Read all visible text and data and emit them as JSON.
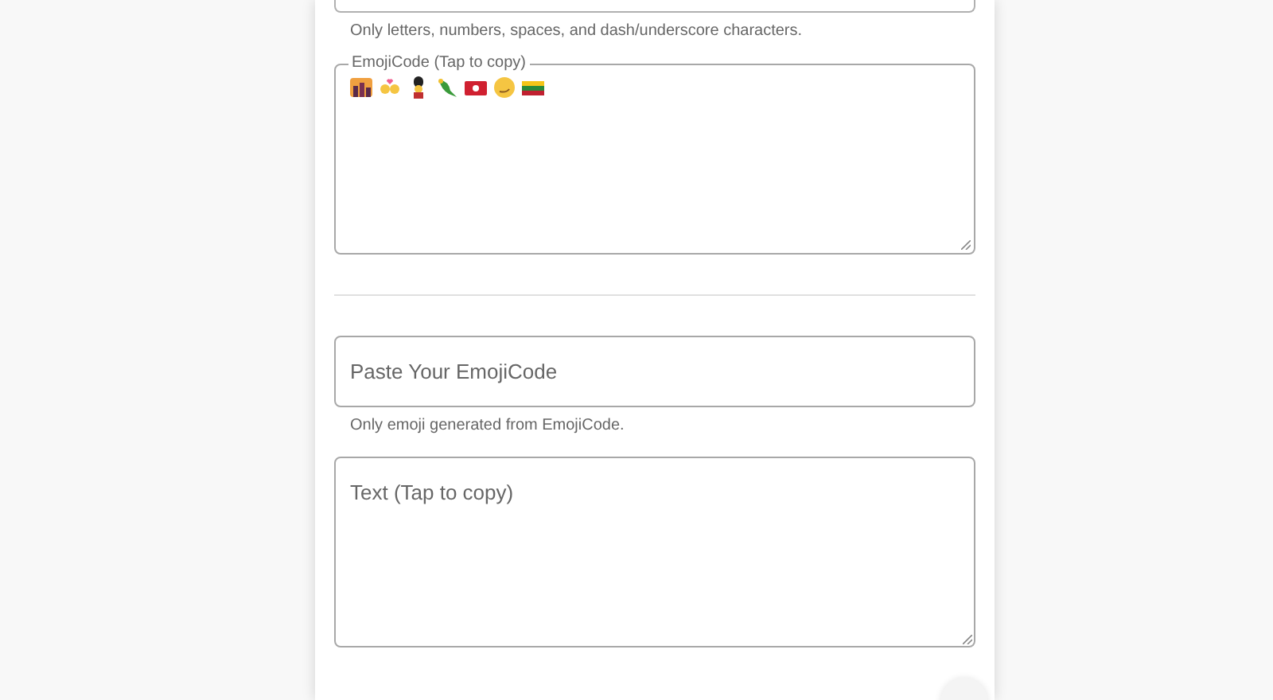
{
  "name_field": {
    "hint": "Only letters, numbers, spaces, and dash/underscore characters."
  },
  "emoji_code": {
    "label": "EmojiCode (Tap to copy)",
    "emoji": [
      {
        "kind": "sunset"
      },
      {
        "kind": "couple"
      },
      {
        "kind": "guard"
      },
      {
        "kind": "parrot"
      },
      {
        "kind": "flag-red"
      },
      {
        "kind": "smirk"
      },
      {
        "kind": "flag-tricolor"
      }
    ]
  },
  "paste_field": {
    "placeholder": "Paste Your EmojiCode",
    "hint": "Only emoji generated from EmojiCode."
  },
  "text_field": {
    "placeholder": "Text (Tap to copy)"
  }
}
